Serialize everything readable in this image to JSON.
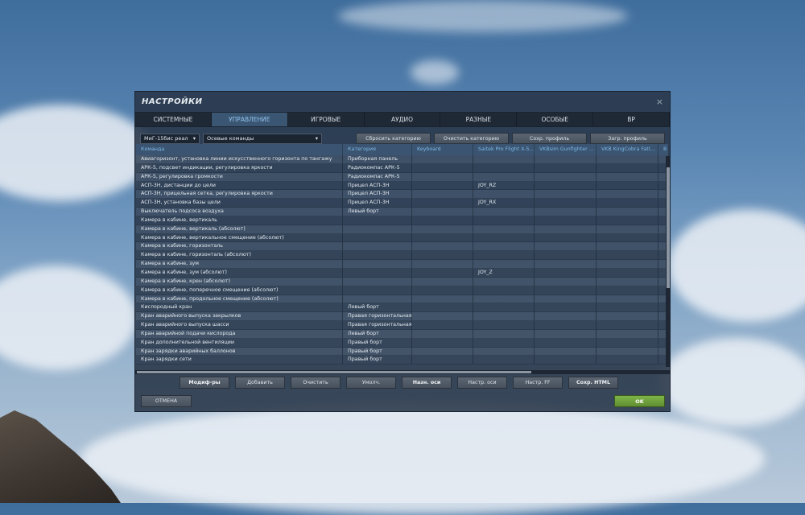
{
  "dialog": {
    "title": "НАСТРОЙКИ",
    "close_glyph": "×"
  },
  "tabs": [
    {
      "label": "СИСТЕМНЫЕ",
      "active": false
    },
    {
      "label": "УПРАВЛЕНИЕ",
      "active": true
    },
    {
      "label": "ИГРОВЫЕ",
      "active": false
    },
    {
      "label": "АУДИО",
      "active": false
    },
    {
      "label": "РАЗНЫЕ",
      "active": false
    },
    {
      "label": "ОСОБЫЕ",
      "active": false
    },
    {
      "label": "ВР",
      "active": false
    }
  ],
  "toolbar": {
    "aircraft_select": "МиГ-15бис реал",
    "category_select": "Осевые команды",
    "dropdown_glyph": "▾",
    "reset_category": "Сбросить категорию",
    "clear_category": "Очистить категорию",
    "save_profile": "Сохр. профиль",
    "load_profile": "Загр. профиль"
  },
  "table": {
    "headers": [
      "Команда",
      "Категория",
      "Keyboard",
      "Saitek Pro Flight X-5...",
      "VKBsim Gunfighter ...",
      "VKB KingCobra Fat(...",
      "B"
    ],
    "rows": [
      [
        "Авиагоризонт, установка линии искусственного горизонта по тангажу",
        "Приборная панель",
        "",
        "",
        "",
        "",
        ""
      ],
      [
        "АРК-5, подсвет индикации, регулировка яркости",
        "Радиокомпас АРК-5",
        "",
        "",
        "",
        "",
        ""
      ],
      [
        "АРК-5, регулировка громкости",
        "Радиокомпас АРК-5",
        "",
        "",
        "",
        "",
        ""
      ],
      [
        "АСП-3Н, дистанции до цели",
        "Прицел АСП-3Н",
        "",
        "JOY_RZ",
        "",
        "",
        ""
      ],
      [
        "АСП-3Н, прицельная сетка, регулировка яркости",
        "Прицел АСП-3Н",
        "",
        "",
        "",
        "",
        ""
      ],
      [
        "АСП-3Н, установка базы цели",
        "Прицел АСП-3Н",
        "",
        "JOY_RX",
        "",
        "",
        ""
      ],
      [
        "Выключатель подсоса воздуха",
        "Левый борт",
        "",
        "",
        "",
        "",
        ""
      ],
      [
        "Камера в кабине, вертикаль",
        "",
        "",
        "",
        "",
        "",
        ""
      ],
      [
        "Камера в кабине, вертикаль (абсолют)",
        "",
        "",
        "",
        "",
        "",
        ""
      ],
      [
        "Камера в кабине, вертикальное смещение (абсолют)",
        "",
        "",
        "",
        "",
        "",
        ""
      ],
      [
        "Камера в кабине, горизонталь",
        "",
        "",
        "",
        "",
        "",
        ""
      ],
      [
        "Камера в кабине, горизонталь (абсолют)",
        "",
        "",
        "",
        "",
        "",
        ""
      ],
      [
        "Камера в кабине, зум",
        "",
        "",
        "",
        "",
        "",
        ""
      ],
      [
        "Камера в кабине, зум (абсолют)",
        "",
        "",
        "JOY_Z",
        "",
        "",
        ""
      ],
      [
        "Камера в кабине, крен (абсолют)",
        "",
        "",
        "",
        "",
        "",
        ""
      ],
      [
        "Камера в кабине, поперечное смещение (абсолют)",
        "",
        "",
        "",
        "",
        "",
        ""
      ],
      [
        "Камера в кабине, продольное смещение (абсолют)",
        "",
        "",
        "",
        "",
        "",
        ""
      ],
      [
        "Кислородный кран",
        "Левый борт",
        "",
        "",
        "",
        "",
        ""
      ],
      [
        "Кран аварийного выпуска закрылков",
        "Правая горизонтальная",
        "",
        "",
        "",
        "",
        ""
      ],
      [
        "Кран аварийного выпуска шасси",
        "Правая горизонтальная",
        "",
        "",
        "",
        "",
        ""
      ],
      [
        "Кран аварийной подачи кислорода",
        "Левый борт",
        "",
        "",
        "",
        "",
        ""
      ],
      [
        "Кран дополнительной вентиляции",
        "Правый борт",
        "",
        "",
        "",
        "",
        ""
      ],
      [
        "Кран зарядки аварийных баллонов",
        "Правый борт",
        "",
        "",
        "",
        "",
        ""
      ],
      [
        "Кран зарядки сети",
        "Правый борт",
        "",
        "",
        "",
        "",
        ""
      ]
    ]
  },
  "bottom_buttons": [
    "Модиф-ры",
    "Добавить",
    "Очистить",
    "Умолч.",
    "Назн. оси",
    "Настр. оси",
    "Настр. FF",
    "Сохр. HTML"
  ],
  "footer": {
    "cancel": "ОТМЕНА",
    "ok": "OK"
  },
  "colors": {
    "accent": "#8fc3ee",
    "ok_green": "#6fa23d",
    "panel": "#283648"
  }
}
